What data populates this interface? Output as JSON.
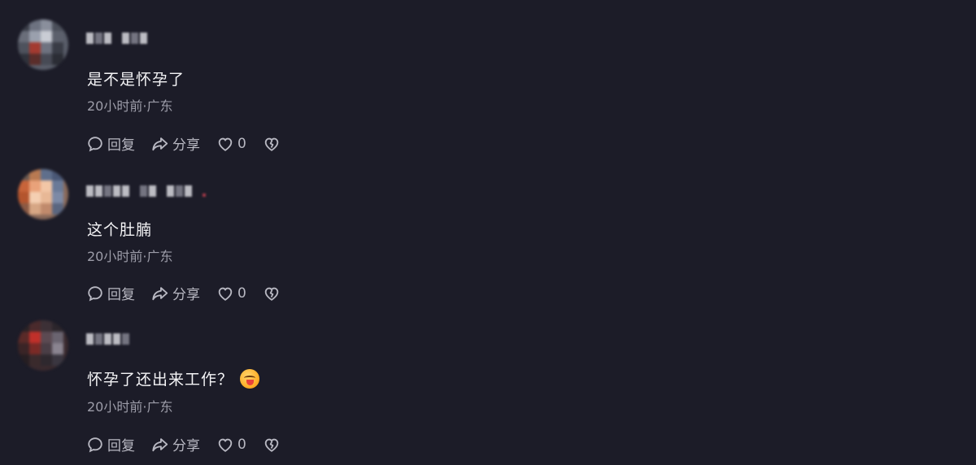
{
  "comments": [
    {
      "text": "是不是怀孕了",
      "meta": "20小时前·广东",
      "reply_label": "回复",
      "share_label": "分享",
      "like_count": "0",
      "has_emoji": false
    },
    {
      "text": "这个肚腩",
      "meta": "20小时前·广东",
      "reply_label": "回复",
      "share_label": "分享",
      "like_count": "0",
      "has_emoji": false
    },
    {
      "text": "怀孕了还出来工作？",
      "meta": "20小时前·广东",
      "reply_label": "回复",
      "share_label": "分享",
      "like_count": "0",
      "has_emoji": true
    }
  ],
  "icons": {
    "reply": "speech-bubble-icon",
    "share": "share-arrow-icon",
    "like": "heart-icon",
    "dislike": "broken-heart-icon",
    "emoji": "tongue-out-face-emoji"
  },
  "colors": {
    "background": "#1c1c28",
    "text": "#f4f4f6",
    "meta": "#9c9ca8",
    "action": "#b8b8c2"
  }
}
